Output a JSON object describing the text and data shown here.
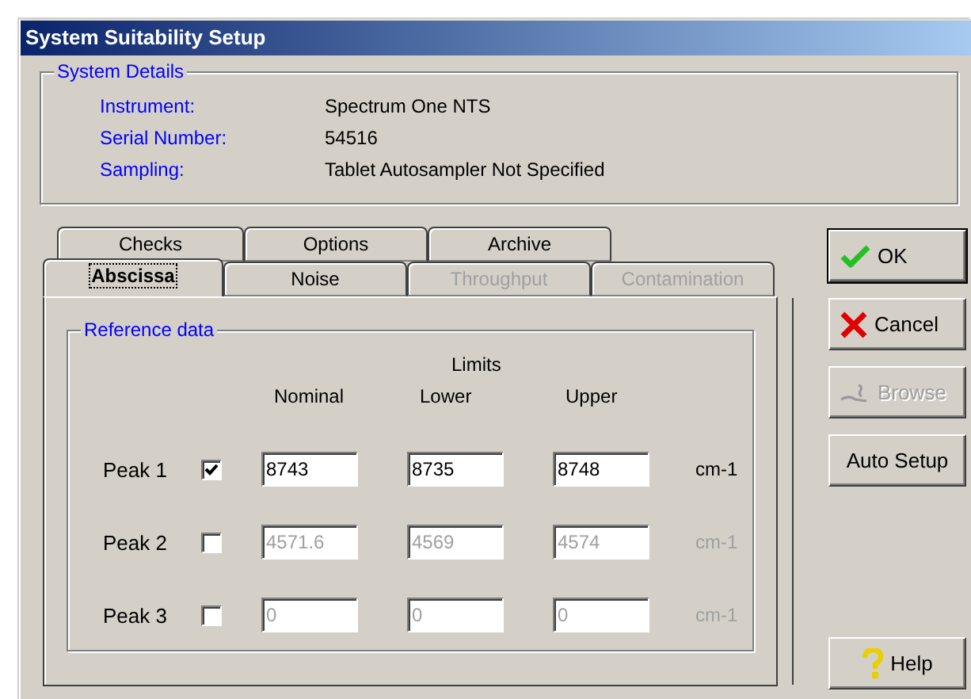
{
  "window": {
    "title": "System Suitability Setup"
  },
  "system_details": {
    "title": "System Details",
    "fields": [
      {
        "label": "Instrument:",
        "value": "Spectrum One NTS"
      },
      {
        "label": "Serial Number:",
        "value": "54516"
      },
      {
        "label": "Sampling:",
        "value": "Tablet Autosampler Not Specified"
      }
    ]
  },
  "tabs_back_row": [
    {
      "label": "Checks",
      "selected": false,
      "disabled": false
    },
    {
      "label": "Options",
      "selected": false,
      "disabled": false
    },
    {
      "label": "Archive",
      "selected": false,
      "disabled": false
    }
  ],
  "tabs_front_row": [
    {
      "label": "Abscissa",
      "selected": true,
      "disabled": false
    },
    {
      "label": "Noise",
      "selected": false,
      "disabled": false
    },
    {
      "label": "Throughput",
      "selected": false,
      "disabled": true
    },
    {
      "label": "Contamination",
      "selected": false,
      "disabled": true
    }
  ],
  "reference_data": {
    "title": "Reference data",
    "limits_label": "Limits",
    "columns": [
      "Nominal",
      "Lower",
      "Upper"
    ],
    "peaks": [
      {
        "label": "Peak 1",
        "checked": true,
        "nominal": "8743",
        "lower": "8735",
        "upper": "8748",
        "unit": "cm-1"
      },
      {
        "label": "Peak 2",
        "checked": false,
        "nominal": "4571.6",
        "lower": "4569",
        "upper": "4574",
        "unit": "cm-1"
      },
      {
        "label": "Peak 3",
        "checked": false,
        "nominal": "0",
        "lower": "0",
        "upper": "0",
        "unit": "cm-1"
      }
    ]
  },
  "buttons": [
    {
      "kind": "ok",
      "label": "OK",
      "disabled": false,
      "default": true
    },
    {
      "kind": "cancel",
      "label": "Cancel",
      "disabled": false,
      "default": false
    },
    {
      "kind": "browse",
      "label": "Browse",
      "disabled": true,
      "default": false
    },
    {
      "kind": "plain",
      "label": "Auto Setup",
      "disabled": false,
      "default": false
    },
    {
      "kind": "help",
      "label": "Help",
      "disabled": false,
      "default": false
    }
  ]
}
